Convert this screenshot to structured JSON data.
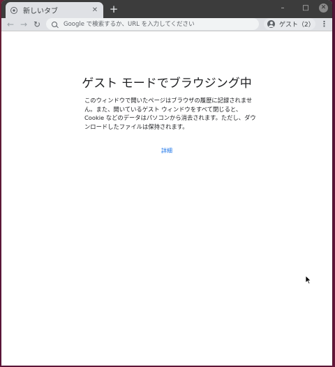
{
  "tab": {
    "title": "新しいタブ",
    "close": "✕"
  },
  "new_tab": "+",
  "window_controls": {
    "minimize": "–",
    "maximize": "□",
    "close": "✕"
  },
  "toolbar": {
    "back": "←",
    "forward": "→",
    "reload": "↻",
    "omnibox_placeholder": "Google で検索するか、URL を入力してください",
    "profile_label": "ゲスト（2）",
    "menu": "⋮"
  },
  "page": {
    "heading": "ゲスト モードでブラウジング中",
    "description": "このウィンドウで開いたページはブラウザの履歴に記録されません。また、開いているゲスト ウィンドウをすべて閉じると、Cookie などのデータはパソコンから消去されます。ただし、ダウンロードしたファイルは保持されます。",
    "learn_more": "詳細"
  },
  "icons": {
    "tab": "globe-icon",
    "search": "search-icon",
    "profile": "avatar-icon",
    "cursor": "mouse-pointer-icon"
  },
  "colors": {
    "tabstrip": "#3c3c3c",
    "toolbar": "#dfe1e5",
    "link": "#1a73e8",
    "text": "#202124"
  }
}
